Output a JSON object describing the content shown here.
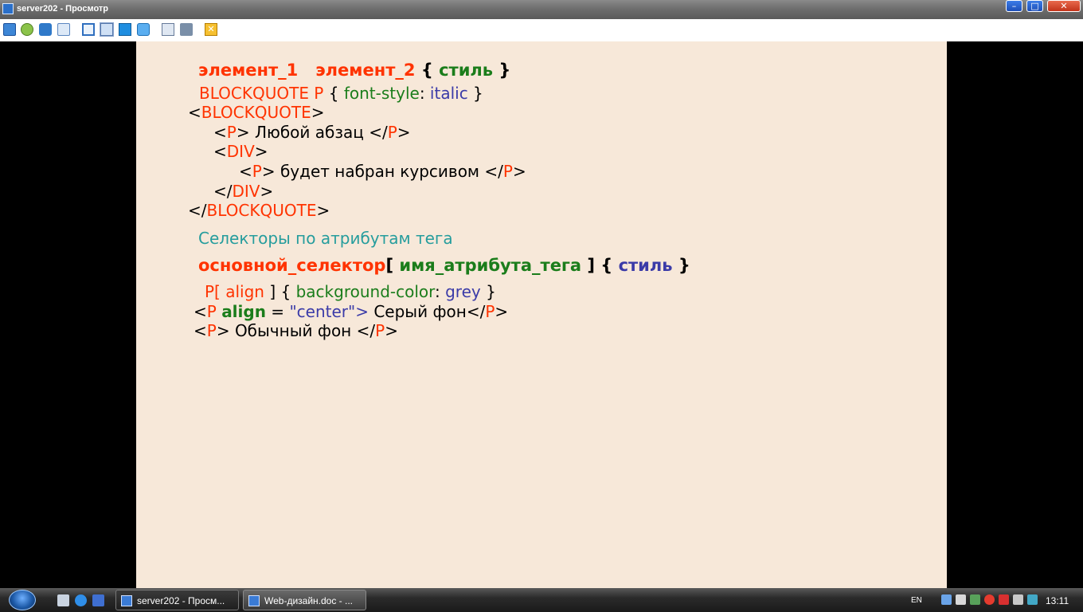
{
  "window": {
    "title": "server202 - Просмотр",
    "close_glyph": "✕",
    "min_glyph": "–",
    "max_glyph": "□"
  },
  "toolbar": {
    "icons": [
      "fullscreen-icon",
      "connect-icon",
      "phone-icon",
      "chat-icon",
      "window-icon",
      "fit-icon",
      "scale-icon",
      "refresh-icon",
      "clipboard-icon",
      "tools-icon",
      "close-session-icon"
    ],
    "close_glyph": "✕"
  },
  "slide": {
    "line1": {
      "a": "элемент_1",
      "b": "элемент_2",
      "open": "{",
      "style": "стиль",
      "close": "}"
    },
    "line2": {
      "sel": "BLOCKQUOTE P",
      "open": "{",
      "prop": "font-style",
      "colon": ":",
      "val": "italic",
      "close": "}"
    },
    "line3": {
      "lt": "<",
      "tag": "BLOCKQUOTE",
      "gt": ">"
    },
    "line4": {
      "lt": "<",
      "tag": "P",
      "text": "> Любой абзац </",
      "tag2": "P",
      "gt": ">"
    },
    "line5": {
      "lt": "<",
      "tag": "DIV",
      "gt": ">"
    },
    "line6": {
      "lt": "<",
      "tag": "P",
      "text": "> будет набран курсивом </",
      "tag2": "P",
      "gt": ">"
    },
    "line7": {
      "lt": "</",
      "tag": "DIV",
      "gt": ">"
    },
    "line8": {
      "lt": "</",
      "tag": "BLOCKQUOTE",
      "gt": ">"
    },
    "heading": "Селекторы по атрибутам тега",
    "line9": {
      "main": "основной_селектор",
      "open": "[",
      "attr": "имя_атрибута_тега",
      "close": "] {",
      "style": "стиль",
      "end": "}"
    },
    "line10": {
      "sel": "P[",
      "attr": "align",
      "close": "] {",
      "prop": "background-color",
      "colon": ":",
      "val": "grey",
      "end": "}"
    },
    "line11": {
      "lt": "<",
      "tag": "P",
      "attr": "align",
      "eq": " = ",
      "q1": "\"",
      "val": "center",
      "q2": "\"",
      "gt": ">",
      "text": " Серый фон</",
      "tag2": "P",
      "gt2": ">"
    },
    "line12": {
      "lt": "<",
      "tag": "P",
      "text": "> Обычный фон </",
      "tag2": "P",
      "gt": ">"
    }
  },
  "taskbar": {
    "tasks": [
      {
        "label": "server202 - Просм..."
      },
      {
        "label": "Web-дизайн.doc - ..."
      }
    ],
    "lang": "EN",
    "clock": "13:11"
  },
  "colors": {
    "red": "#ff3300",
    "green": "#1b7d1b",
    "blue": "#3b3ba8",
    "teal": "#269d9d",
    "slide_bg": "#f7e8d9"
  }
}
